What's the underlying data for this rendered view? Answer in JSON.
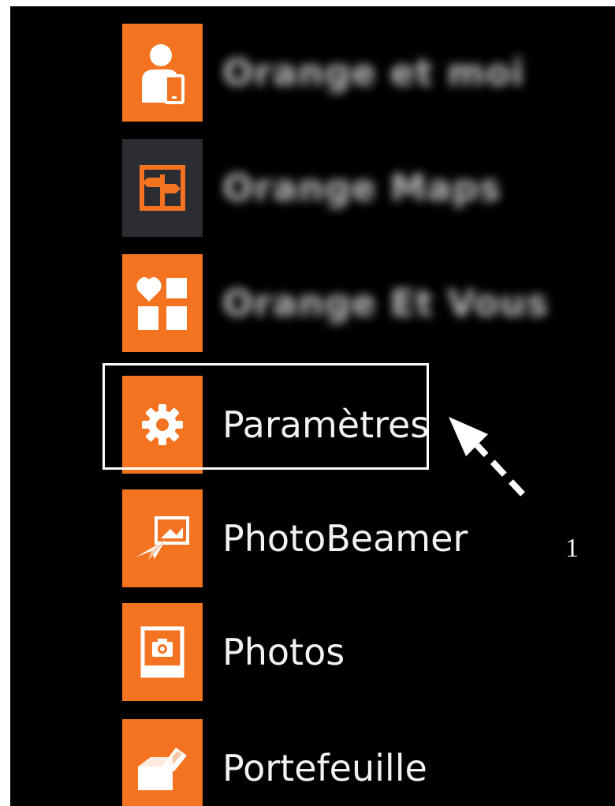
{
  "colors": {
    "background": "#000000",
    "tile_accent": "#f47321",
    "tile_dark": "#2b2d33",
    "text": "#f2f2f2",
    "annotation": "#ffffff"
  },
  "apps": [
    {
      "label": "Orange et moi",
      "icon": "person-phone-icon",
      "tile_color": "#f47321",
      "blurred": true
    },
    {
      "label": "Orange Maps",
      "icon": "map-signpost-icon",
      "tile_color": "#2b2d33",
      "blurred": true
    },
    {
      "label": "Orange Et Vous",
      "icon": "heart-squares-icon",
      "tile_color": "#f47321",
      "blurred": true
    },
    {
      "label": "Paramètres",
      "icon": "gear-icon",
      "tile_color": "#f47321",
      "blurred": false
    },
    {
      "label": "PhotoBeamer",
      "icon": "paper-plane-photo-icon",
      "tile_color": "#f47321",
      "blurred": false
    },
    {
      "label": "Photos",
      "icon": "camera-frame-icon",
      "tile_color": "#f47321",
      "blurred": false
    },
    {
      "label": "Portefeuille",
      "icon": "wallet-icon",
      "tile_color": "#f47321",
      "blurred": false
    }
  ],
  "annotation": {
    "number": "1",
    "highlighted_item": "Paramètres"
  }
}
